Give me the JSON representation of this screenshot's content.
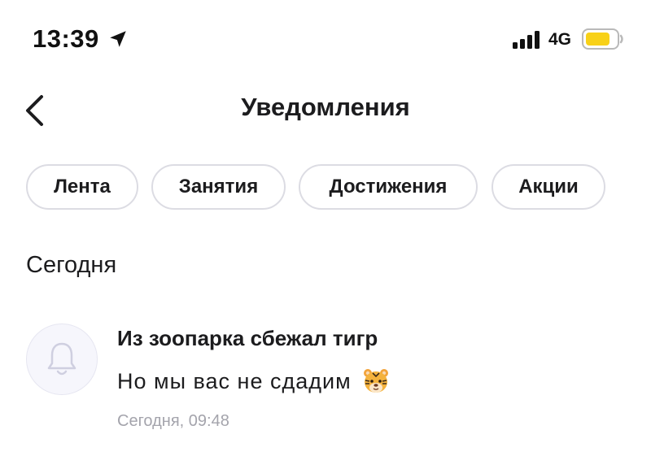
{
  "status_bar": {
    "time": "13:39",
    "network": "4G",
    "battery_color": "#f8d118"
  },
  "header": {
    "title": "Уведомления"
  },
  "filters": [
    {
      "label": "Лента"
    },
    {
      "label": "Занятия"
    },
    {
      "label": "Достижения"
    },
    {
      "label": "Акции"
    }
  ],
  "section": {
    "title": "Сегодня"
  },
  "notifications": [
    {
      "title": "Из зоопарка сбежал тигр",
      "body": "Но мы вас не сдадим",
      "emoji": "tiger-face-icon",
      "time": "Сегодня, 09:48",
      "icon": "bell-icon"
    }
  ],
  "colors": {
    "chip_border": "#dcdce3",
    "muted_text": "#a4a4ac",
    "avatar_bg": "#f6f6fc"
  }
}
